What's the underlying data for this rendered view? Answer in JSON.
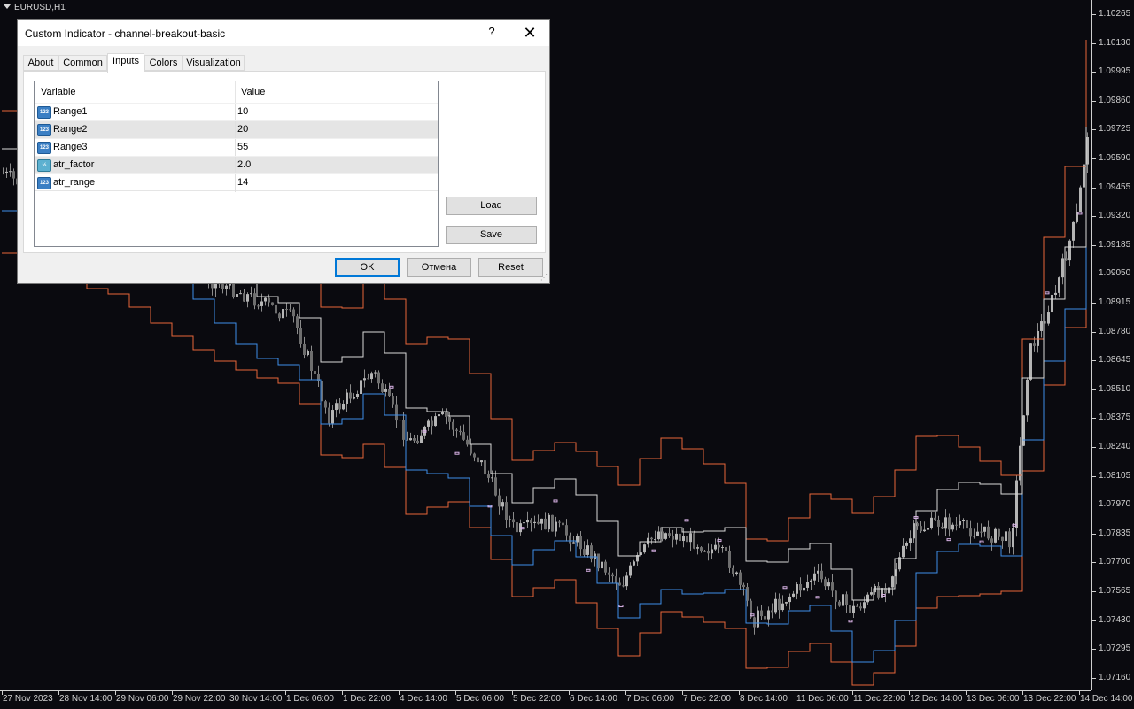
{
  "chart": {
    "symbol": "EURUSD,H1",
    "price_labels": [
      "1.10265",
      "1.10130",
      "1.09995",
      "1.09860",
      "1.09725",
      "1.09590",
      "1.09455",
      "1.09320",
      "1.09185",
      "1.09050",
      "1.08915",
      "1.08780",
      "1.08645",
      "1.08510",
      "1.08375",
      "1.08240",
      "1.08105",
      "1.07970",
      "1.07835",
      "1.07700",
      "1.07565",
      "1.07430",
      "1.07295",
      "1.07160"
    ],
    "time_labels": [
      "27 Nov 2023",
      "28 Nov 14:00",
      "29 Nov 06:00",
      "29 Nov 22:00",
      "30 Nov 14:00",
      "1 Dec 06:00",
      "1 Dec 22:00",
      "4 Dec 14:00",
      "5 Dec 06:00",
      "5 Dec 22:00",
      "6 Dec 14:00",
      "7 Dec 06:00",
      "7 Dec 22:00",
      "8 Dec 14:00",
      "11 Dec 06:00",
      "11 Dec 22:00",
      "12 Dec 14:00",
      "13 Dec 06:00",
      "13 Dec 22:00",
      "14 Dec 14:00"
    ],
    "colors": {
      "background": "#0a0a0f",
      "candle": "#8c8c8c",
      "upper_band": "#e8663a",
      "lower_band": "#3f8fe8",
      "mid_line": "#d9d9d9",
      "marker": "#d9b3e6"
    }
  },
  "dialog": {
    "title": "Custom Indicator - channel-breakout-basic",
    "help_label": "?",
    "close_label": "✕",
    "tabs": [
      {
        "label": "About",
        "active": false
      },
      {
        "label": "Common",
        "active": false
      },
      {
        "label": "Inputs",
        "active": true
      },
      {
        "label": "Colors",
        "active": false
      },
      {
        "label": "Visualization",
        "active": false
      }
    ],
    "grid": {
      "headers": [
        "Variable",
        "Value"
      ],
      "rows": [
        {
          "variable": "Range1",
          "value": "10",
          "icon": "123",
          "icon_name": "integer-icon"
        },
        {
          "variable": "Range2",
          "value": "20",
          "icon": "123",
          "icon_name": "integer-icon"
        },
        {
          "variable": "Range3",
          "value": "55",
          "icon": "123",
          "icon_name": "integer-icon"
        },
        {
          "variable": "atr_factor",
          "value": "2.0",
          "icon": "½",
          "icon_name": "double-icon"
        },
        {
          "variable": "atr_range",
          "value": "14",
          "icon": "123",
          "icon_name": "integer-icon"
        }
      ]
    },
    "buttons": {
      "load": "Load",
      "save": "Save",
      "ok": "OK",
      "cancel": "Отмена",
      "reset": "Reset"
    }
  }
}
